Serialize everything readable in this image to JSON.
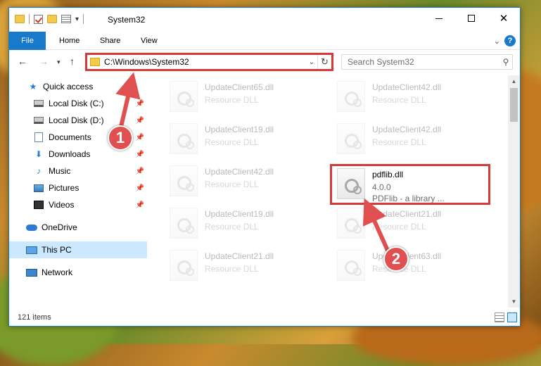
{
  "window": {
    "title": "System32"
  },
  "ribbon": {
    "tabs": [
      {
        "label": "File"
      },
      {
        "label": "Home"
      },
      {
        "label": "Share"
      },
      {
        "label": "View"
      }
    ]
  },
  "nav": {
    "address": "C:\\Windows\\System32",
    "search_placeholder": "Search System32"
  },
  "sidebar": {
    "items": [
      {
        "label": "Quick access",
        "icon": "star-icon"
      },
      {
        "label": "Local Disk (C:)",
        "icon": "disk-icon",
        "pinned": true
      },
      {
        "label": "Local Disk (D:)",
        "icon": "disk-icon",
        "pinned": true
      },
      {
        "label": "Documents",
        "icon": "documents-icon",
        "pinned": true
      },
      {
        "label": "Downloads",
        "icon": "downloads-icon",
        "pinned": true
      },
      {
        "label": "Music",
        "icon": "music-icon",
        "pinned": true
      },
      {
        "label": "Pictures",
        "icon": "pictures-icon",
        "pinned": true
      },
      {
        "label": "Videos",
        "icon": "videos-icon",
        "pinned": true
      },
      {
        "label": "OneDrive",
        "icon": "onedrive-icon"
      },
      {
        "label": "This PC",
        "icon": "this-pc-icon",
        "selected": true
      },
      {
        "label": "Network",
        "icon": "network-icon"
      }
    ]
  },
  "files": [
    {
      "name": "UpdateClient65.dll",
      "desc": "Resource DLL"
    },
    {
      "name": "UpdateClient42.dll",
      "desc": "Resource DLL"
    },
    {
      "name": "UpdateClient19.dll",
      "desc": "Resource DLL"
    },
    {
      "name": "UpdateClient42.dll",
      "desc": "Resource DLL"
    },
    {
      "name": "UpdateClient42.dll",
      "desc": "Resource DLL"
    },
    {
      "name": "pdflib.dll",
      "desc": "4.0.0",
      "desc2": "PDFlib - a library ..."
    },
    {
      "name": "UpdateClient19.dll",
      "desc": "Resource DLL"
    },
    {
      "name": "UpdateClient21.dll",
      "desc": "Resource DLL"
    },
    {
      "name": "UpdateClient21.dll",
      "desc": "Resource DLL"
    },
    {
      "name": "UpdateClient63.dll",
      "desc": "Resource DLL"
    }
  ],
  "status": {
    "item_count": "121 items"
  },
  "annotations": {
    "step1": "1",
    "step2": "2",
    "color": "#e05050"
  }
}
